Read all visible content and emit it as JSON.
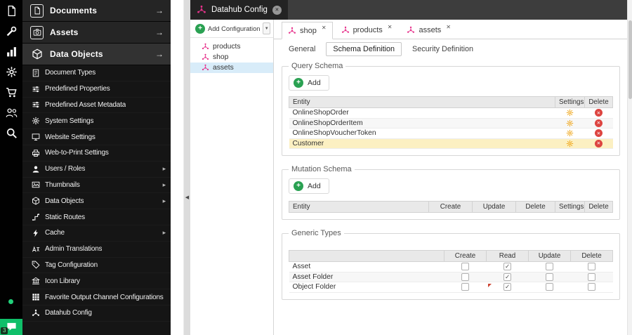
{
  "colors": {
    "accent_green": "#2aa152",
    "accent_pink": "#e7338c",
    "gear_yellow": "#efa312",
    "delete_red": "#dd4440",
    "row_highlight": "#fcf0c2",
    "tree_selection": "#d8ecf9"
  },
  "iconbar": {
    "items": [
      {
        "name": "documents-shortcut-icon",
        "icon": "file"
      },
      {
        "name": "tools-icon",
        "icon": "wrench"
      },
      {
        "name": "reports-icon",
        "icon": "chart"
      },
      {
        "name": "settings-shortcut-icon",
        "icon": "gear"
      },
      {
        "name": "ecommerce-icon",
        "icon": "cart"
      },
      {
        "name": "users-shortcut-icon",
        "icon": "users"
      },
      {
        "name": "search-icon",
        "icon": "search"
      }
    ],
    "notification_count": "3"
  },
  "sidebar": {
    "sections": [
      {
        "label": "Documents",
        "icon": "file",
        "expanded": false
      },
      {
        "label": "Assets",
        "icon": "camera",
        "expanded": false
      },
      {
        "label": "Data Objects",
        "icon": "cube",
        "expanded": true
      }
    ],
    "items": [
      {
        "label": "Document Types",
        "icon": "doc-lines",
        "submenu": false
      },
      {
        "label": "Predefined Properties",
        "icon": "sliders",
        "submenu": false
      },
      {
        "label": "Predefined Asset Metadata",
        "icon": "sliders",
        "submenu": false
      },
      {
        "label": "System Settings",
        "icon": "gear",
        "submenu": false
      },
      {
        "label": "Website Settings",
        "icon": "monitor",
        "submenu": false
      },
      {
        "label": "Web-to-Print Settings",
        "icon": "printer",
        "submenu": false
      },
      {
        "label": "Users / Roles",
        "icon": "user",
        "submenu": true
      },
      {
        "label": "Thumbnails",
        "icon": "image",
        "submenu": true
      },
      {
        "label": "Data Objects",
        "icon": "cube",
        "submenu": true
      },
      {
        "label": "Static Routes",
        "icon": "route",
        "submenu": false
      },
      {
        "label": "Cache",
        "icon": "lightning",
        "submenu": true
      },
      {
        "label": "Admin Translations",
        "icon": "translate",
        "submenu": false
      },
      {
        "label": "Tag Configuration",
        "icon": "tag",
        "submenu": false
      },
      {
        "label": "Icon Library",
        "icon": "bank",
        "submenu": false
      },
      {
        "label": "Favorite Output Channel Configurations",
        "icon": "grid",
        "submenu": false
      },
      {
        "label": "Datahub Config",
        "icon": "hub",
        "submenu": false
      }
    ]
  },
  "window": {
    "tab": {
      "label": "Datahub Config",
      "icon": "hub"
    }
  },
  "config_panel": {
    "add_button_label": "Add Configuration",
    "tree": [
      {
        "label": "products",
        "selected": false
      },
      {
        "label": "shop",
        "selected": false
      },
      {
        "label": "assets",
        "selected": true
      }
    ]
  },
  "editor": {
    "tabs": [
      {
        "label": "shop",
        "active": true
      },
      {
        "label": "products",
        "active": false
      },
      {
        "label": "assets",
        "active": false
      }
    ],
    "subtabs": [
      {
        "label": "General",
        "active": false
      },
      {
        "label": "Schema Definition",
        "active": true
      },
      {
        "label": "Security Definition",
        "active": false
      }
    ],
    "query_schema": {
      "legend": "Query Schema",
      "add_label": "Add",
      "columns": [
        "Entity",
        "Settings",
        "Delete"
      ],
      "rows": [
        {
          "entity": "OnlineShopOrder",
          "highlighted": false
        },
        {
          "entity": "OnlineShopOrderItem",
          "highlighted": false
        },
        {
          "entity": "OnlineShopVoucherToken",
          "highlighted": false
        },
        {
          "entity": "Customer",
          "highlighted": true
        }
      ]
    },
    "mutation_schema": {
      "legend": "Mutation Schema",
      "add_label": "Add",
      "columns": [
        "Entity",
        "Create",
        "Update",
        "Delete",
        "Settings",
        "Delete"
      ]
    },
    "generic_types": {
      "legend": "Generic Types",
      "columns": [
        "",
        "Create",
        "Read",
        "Update",
        "Delete"
      ],
      "rows": [
        {
          "name": "Asset",
          "create": false,
          "read": true,
          "update": false,
          "delete": false,
          "dirty": null
        },
        {
          "name": "Asset Folder",
          "create": false,
          "read": true,
          "update": false,
          "delete": false,
          "dirty": null
        },
        {
          "name": "Object Folder",
          "create": false,
          "read": true,
          "update": false,
          "delete": false,
          "dirty": "read"
        }
      ]
    }
  }
}
